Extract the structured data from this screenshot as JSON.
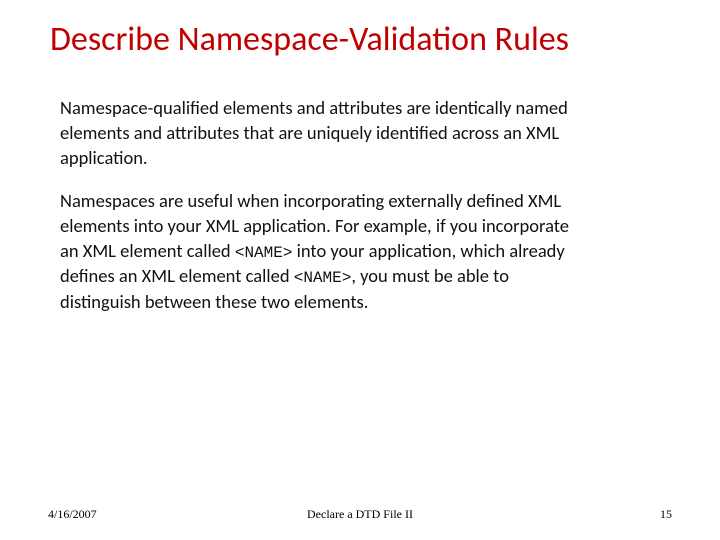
{
  "title": "Describe Namespace-Validation Rules",
  "body": {
    "p1": "Namespace-qualified elements and attributes are identically named elements and attributes that are uniquely identified across an XML application.",
    "p2_a": "Namespaces are useful when incorporating externally defined XML elements into your XML application. For example, if you incorporate an XML element called ",
    "p2_tag1": "<NAME>",
    "p2_b": " into your application, which already defines an XML element called ",
    "p2_tag2": "<NAME>",
    "p2_c": ", you must be able to distinguish between these two elements."
  },
  "footer": {
    "date": "4/16/2007",
    "center": "Declare a DTD File II",
    "page": "15"
  }
}
